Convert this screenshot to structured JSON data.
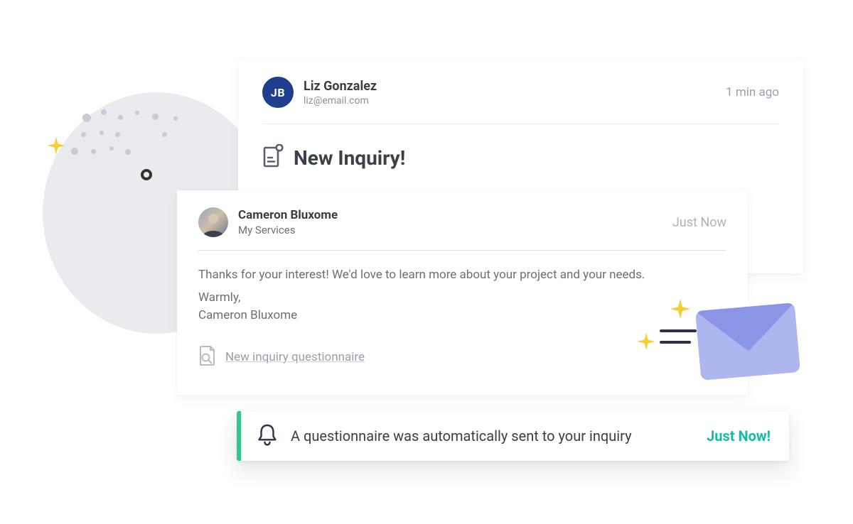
{
  "card1": {
    "avatar_initials": "JB",
    "name": "Liz Gonzalez",
    "email": "liz@email.com",
    "timestamp": "1 min ago",
    "title": "New Inquiry!"
  },
  "card2": {
    "name": "Cameron Bluxome",
    "subtitle": "My Services",
    "timestamp": "Just Now",
    "body_line1": "Thanks for your interest! We'd love to learn more about your project and your needs.",
    "body_sign1": "Warmly,",
    "body_sign2": "Cameron Bluxome",
    "attachment_label": "New inquiry questionnaire"
  },
  "toast": {
    "message": "A questionnaire was automatically sent to your inquiry",
    "timestamp": "Just Now!"
  }
}
